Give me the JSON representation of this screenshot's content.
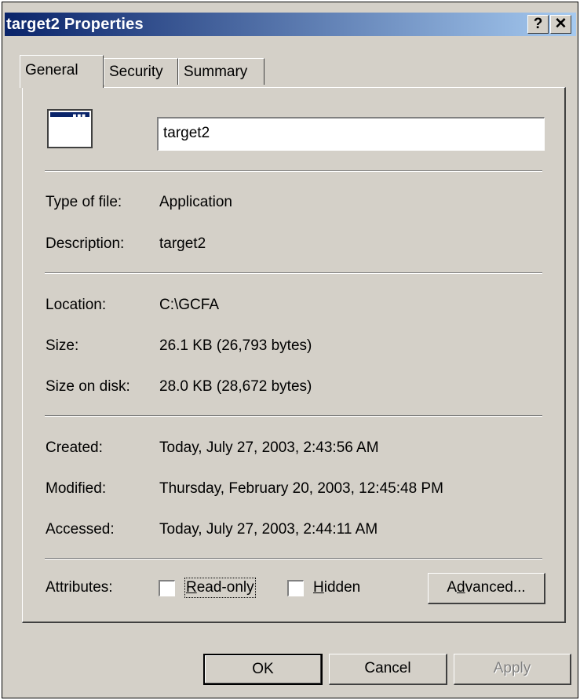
{
  "window": {
    "title": "target2 Properties",
    "help_button": "?",
    "close_button": "✕"
  },
  "tabs": [
    {
      "label": "General",
      "active": true
    },
    {
      "label": "Security",
      "active": false
    },
    {
      "label": "Summary",
      "active": false
    }
  ],
  "file": {
    "name": "target2",
    "icon": "application-window-icon"
  },
  "details": {
    "type_label": "Type of file:",
    "type_value": "Application",
    "description_label": "Description:",
    "description_value": "target2",
    "location_label": "Location:",
    "location_value": "C:\\GCFA",
    "size_label": "Size:",
    "size_value": "26.1 KB (26,793 bytes)",
    "size_on_disk_label": "Size on disk:",
    "size_on_disk_value": "28.0 KB (28,672 bytes)",
    "created_label": "Created:",
    "created_value": "Today, July 27, 2003, 2:43:56 AM",
    "modified_label": "Modified:",
    "modified_value": "Thursday, February 20, 2003, 12:45:48 PM",
    "accessed_label": "Accessed:",
    "accessed_value": "Today, July 27, 2003, 2:44:11 AM"
  },
  "attributes": {
    "label": "Attributes:",
    "readonly": {
      "key": "R",
      "rest": "ead-only",
      "checked": false
    },
    "hidden": {
      "key": "H",
      "rest": "idden",
      "checked": false
    },
    "advanced": {
      "pre": "A",
      "key": "d",
      "rest": "vanced..."
    }
  },
  "buttons": {
    "ok": "OK",
    "cancel": "Cancel",
    "apply": "Apply"
  }
}
